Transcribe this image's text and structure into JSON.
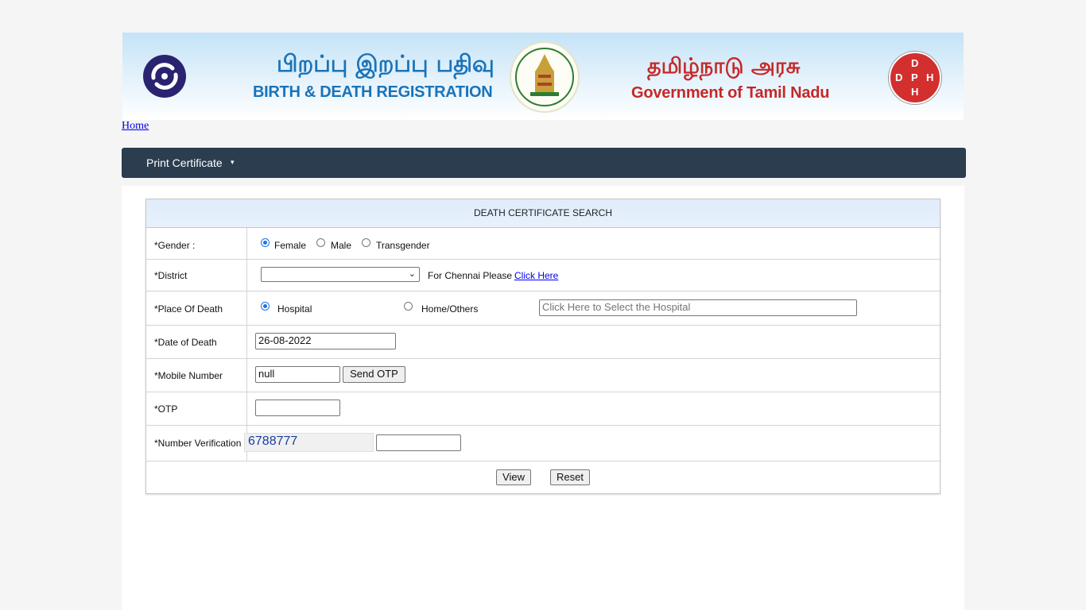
{
  "header": {
    "tamil_title": "பிறப்பு இறப்பு பதிவு",
    "english_title": "BIRTH & DEATH REGISTRATION",
    "tamil_gov": "தமிழ்நாடு அரசு",
    "english_gov": "Government of Tamil Nadu",
    "dph_letters": [
      "D",
      "D",
      "P",
      "H",
      "H"
    ],
    "colors": {
      "title_blue": "#1a73b8",
      "gov_red": "#c62828",
      "navbar": "#2b3d4f"
    }
  },
  "breadcrumb": {
    "home": "Home"
  },
  "nav": {
    "print_certificate": "Print Certificate",
    "caret": "▾"
  },
  "form": {
    "title": "DEATH CERTIFICATE SEARCH",
    "gender": {
      "label": "*Gender :",
      "options": [
        "Female",
        "Male",
        "Transgender"
      ],
      "selected": "Female"
    },
    "district": {
      "label": "*District",
      "value": "",
      "chennai_text": "For Chennai Please",
      "chennai_link": "Click Here"
    },
    "place_of_death": {
      "label": "*Place Of Death",
      "options": [
        "Hospital",
        "Home/Others"
      ],
      "selected": "Hospital",
      "hospital_placeholder": "Click Here to Select the Hospital"
    },
    "date_of_death": {
      "label": "*Date of Death",
      "value": "26-08-2022"
    },
    "mobile": {
      "label": "*Mobile Number",
      "value": "null",
      "send_otp": "Send OTP"
    },
    "otp": {
      "label": "*OTP",
      "value": ""
    },
    "verification": {
      "label": "*Number Verification",
      "captcha": "6788777",
      "value": ""
    },
    "buttons": {
      "view": "View",
      "reset": "Reset"
    }
  }
}
